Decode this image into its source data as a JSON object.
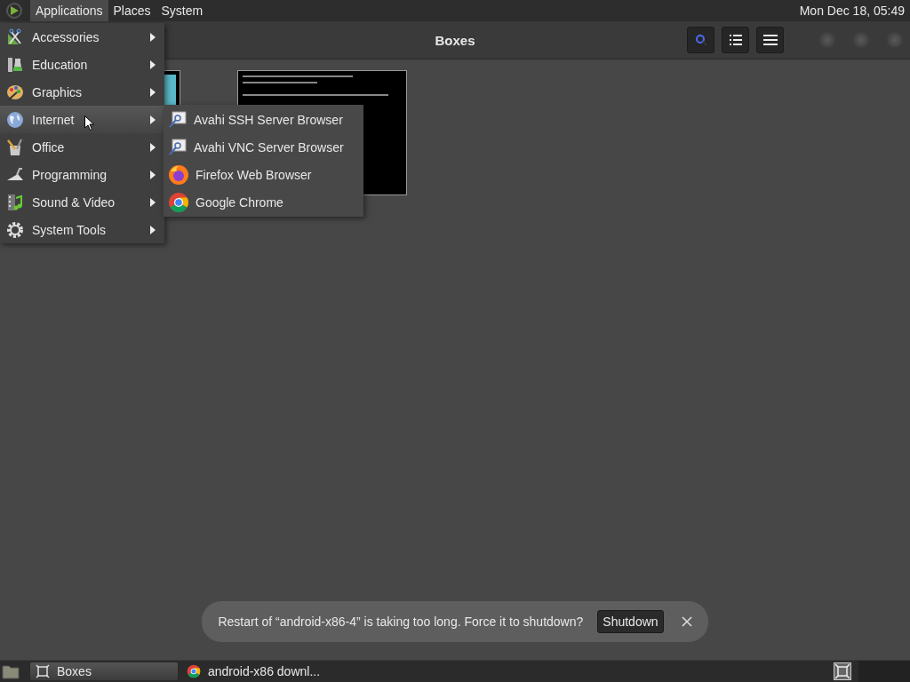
{
  "top_panel": {
    "menus": [
      {
        "label": "Applications",
        "selected": true
      },
      {
        "label": "Places",
        "selected": false
      },
      {
        "label": "System",
        "selected": false
      }
    ],
    "clock": "Mon Dec 18, 05:49"
  },
  "boxes_window": {
    "title": "Boxes",
    "thumbnails": [
      {
        "kind": "vm"
      },
      {
        "kind": "terminal"
      }
    ]
  },
  "applications_menu": [
    {
      "label": "Accessories",
      "selected": false
    },
    {
      "label": "Education",
      "selected": false
    },
    {
      "label": "Graphics",
      "selected": false
    },
    {
      "label": "Internet",
      "selected": true
    },
    {
      "label": "Office",
      "selected": false
    },
    {
      "label": "Programming",
      "selected": false
    },
    {
      "label": "Sound & Video",
      "selected": false
    },
    {
      "label": "System Tools",
      "selected": false
    }
  ],
  "internet_submenu": [
    {
      "label": "Avahi SSH Server Browser",
      "kind": "avahi"
    },
    {
      "label": "Avahi VNC Server Browser",
      "kind": "avahi"
    },
    {
      "label": "Firefox Web Browser",
      "kind": "firefox"
    },
    {
      "label": "Google Chrome",
      "kind": "chrome"
    }
  ],
  "notification": {
    "message": "Restart of “android-x86-4” is taking too long. Force it to shutdown?",
    "button": "Shutdown"
  },
  "taskbar": {
    "tasks": [
      {
        "label": "Boxes",
        "selected": true,
        "kind": "boxes"
      },
      {
        "label": "android-x86 downl...",
        "selected": false,
        "kind": "chrome"
      }
    ]
  }
}
